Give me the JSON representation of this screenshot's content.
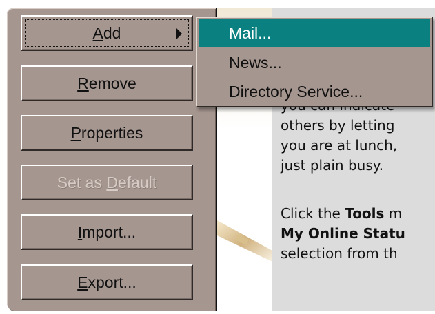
{
  "buttons": {
    "add": {
      "label": "Add",
      "mnemonic": "A",
      "rest": "dd"
    },
    "remove": {
      "mnemonic": "R",
      "rest": "emove"
    },
    "properties": {
      "mnemonic": "P",
      "rest": "roperties"
    },
    "set_default": {
      "pre": "Set as ",
      "mnemonic": "D",
      "rest": "efault",
      "enabled": false
    },
    "import": {
      "mnemonic": "I",
      "rest": "mport..."
    },
    "export": {
      "mnemonic": "E",
      "rest": "xport..."
    }
  },
  "submenu": {
    "items": [
      {
        "label": "Mail...",
        "selected": true
      },
      {
        "label": "News...",
        "selected": false
      },
      {
        "label": "Directory Service...",
        "selected": false
      }
    ],
    "highlight_color": "#0a8080"
  },
  "content": {
    "lines_top": [
      "you can indicate",
      "others by letting",
      "you are at lunch,",
      "just plain busy."
    ],
    "line5_pre": "Click the ",
    "line5_bold": "Tools",
    "line5_post": " m",
    "line6_bold": "My Online Statu",
    "line7": "selection from th"
  },
  "colors": {
    "panel": "#a69690",
    "content_bg": "#dcdcdc"
  }
}
